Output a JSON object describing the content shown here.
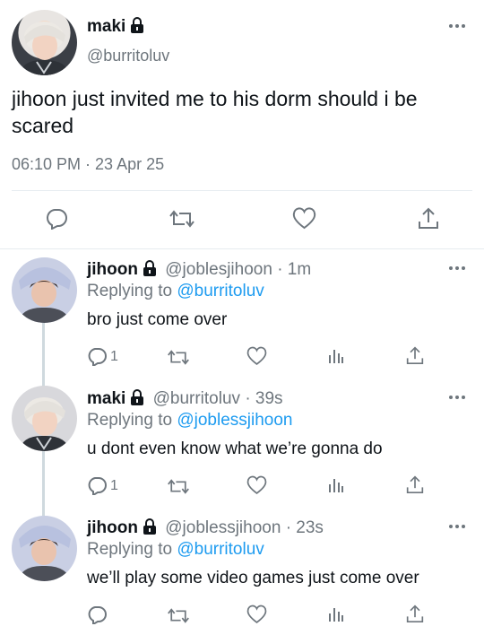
{
  "main": {
    "name": "maki",
    "handle": "@burritoluv",
    "text": "jihoon just invited me to his dorm should i be scared",
    "timestamp": "06:10 PM · 23 Apr 25",
    "actions": [
      "reply-icon",
      "retweet-icon",
      "like-icon",
      "share-icon"
    ]
  },
  "replies": [
    {
      "name": "jihoon",
      "handle": "@joblesjihoon",
      "time": "· 1m",
      "replying_prefix": "Replying to",
      "replying_to": "@burritoluv",
      "text": "bro just come over",
      "reply_count": "1"
    },
    {
      "name": "maki",
      "handle": "@burritoluv",
      "time": "· 39s",
      "replying_prefix": "Replying to",
      "replying_to": "@joblessjihoon",
      "text": "u dont even know what we’re gonna do",
      "reply_count": "1"
    },
    {
      "name": "jihoon",
      "handle": "@joblessjihoon",
      "time": "· 23s",
      "replying_prefix": "Replying to",
      "replying_to": "@burritoluv",
      "text": "we’ll play some video games just come over",
      "reply_count": ""
    }
  ],
  "colors": {
    "link": "#1d9bf0",
    "muted": "#6e767d",
    "divider": "#e6ecf0",
    "thread_line": "#cfd9de"
  }
}
